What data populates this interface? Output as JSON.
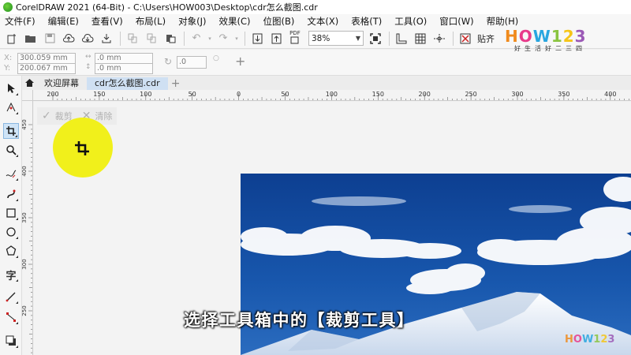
{
  "window": {
    "title": "CorelDRAW 2021 (64-Bit) - C:\\Users\\HOW003\\Desktop\\cdr怎么截图.cdr"
  },
  "menu": [
    "文件(F)",
    "编辑(E)",
    "查看(V)",
    "布局(L)",
    "对象(J)",
    "效果(C)",
    "位图(B)",
    "文本(X)",
    "表格(T)",
    "工具(O)",
    "窗口(W)",
    "帮助(H)"
  ],
  "toolbar": {
    "zoom_value": "38%",
    "pdf_label": "PDF",
    "paste_label": "贴齐"
  },
  "property_bar": {
    "x_label": "X:",
    "y_label": "Y:",
    "x_value": "300.059 mm",
    "y_value": "200.067 mm",
    "width_value": ".0 mm",
    "height_value": ".0 mm",
    "rotation_value": ".0"
  },
  "tabs": {
    "welcome_label": "欢迎屏幕",
    "document_label": "cdr怎么截图.cdr"
  },
  "ruler": {
    "h_labels": [
      "200",
      "150",
      "100",
      "50",
      "0",
      "50",
      "100",
      "150",
      "200",
      "250",
      "300",
      "350",
      "400"
    ],
    "v_labels": [
      "450",
      "400",
      "350",
      "300",
      "250"
    ]
  },
  "crop_toolbar": {
    "crop_label": "裁剪",
    "clear_label": "清除"
  },
  "subtitle": "选择工具箱中的【裁剪工具】",
  "watermark": {
    "brand": "HOW123",
    "slogan": "好生活好二三四",
    "colors": [
      "#f08a1c",
      "#e83a8a",
      "#29a6e0",
      "#8ac43f",
      "#f5c518",
      "#9b59b6"
    ]
  },
  "colors": {
    "highlight": "#f1f009",
    "tab_active": "#cfe0f3",
    "sky": "#0f4aa0"
  }
}
